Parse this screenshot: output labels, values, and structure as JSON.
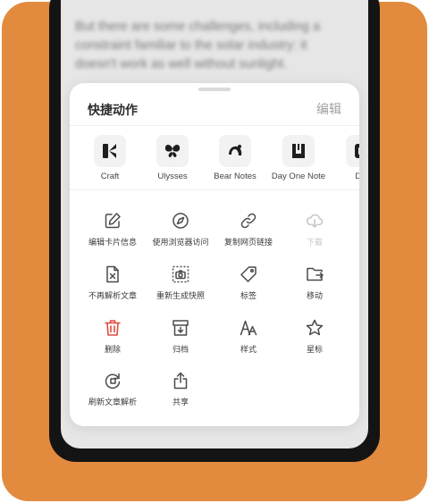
{
  "background_text": "But there are some challenges, including a constraint familiar to the solar industry: it doesn't work as well without sunlight.",
  "sheet": {
    "title": "快捷动作",
    "edit_label": "编辑"
  },
  "apps": [
    {
      "label": "Craft",
      "icon": "craft-icon"
    },
    {
      "label": "Ulysses",
      "icon": "butterfly-icon"
    },
    {
      "label": "Bear Notes",
      "icon": "bear-icon"
    },
    {
      "label": "Day One Note",
      "icon": "day-one-icon"
    },
    {
      "label": "Dra",
      "icon": "drafts-icon"
    }
  ],
  "actions": [
    {
      "label": "编辑卡片信息",
      "icon": "edit-icon"
    },
    {
      "label": "使用浏览器访问",
      "icon": "compass-icon"
    },
    {
      "label": "复制网页链接",
      "icon": "link-icon"
    },
    {
      "label": "下载",
      "icon": "cloud-download-icon",
      "disabled": true
    },
    {
      "label": "不再解析文章",
      "icon": "file-x-icon"
    },
    {
      "label": "重新生成快照",
      "icon": "camera-icon"
    },
    {
      "label": "标签",
      "icon": "tag-icon"
    },
    {
      "label": "移动",
      "icon": "folder-move-icon"
    },
    {
      "label": "删除",
      "icon": "trash-icon"
    },
    {
      "label": "归档",
      "icon": "archive-icon"
    },
    {
      "label": "样式",
      "icon": "font-style-icon"
    },
    {
      "label": "星标",
      "icon": "star-icon"
    },
    {
      "label": "刷新文章解析",
      "icon": "refresh-icon"
    },
    {
      "label": "共享",
      "icon": "share-icon"
    }
  ],
  "colors": {
    "background": "#e28a3e",
    "danger": "#e04a3f",
    "icon": "#4a4a4a",
    "disabled": "#c4c4c4"
  }
}
